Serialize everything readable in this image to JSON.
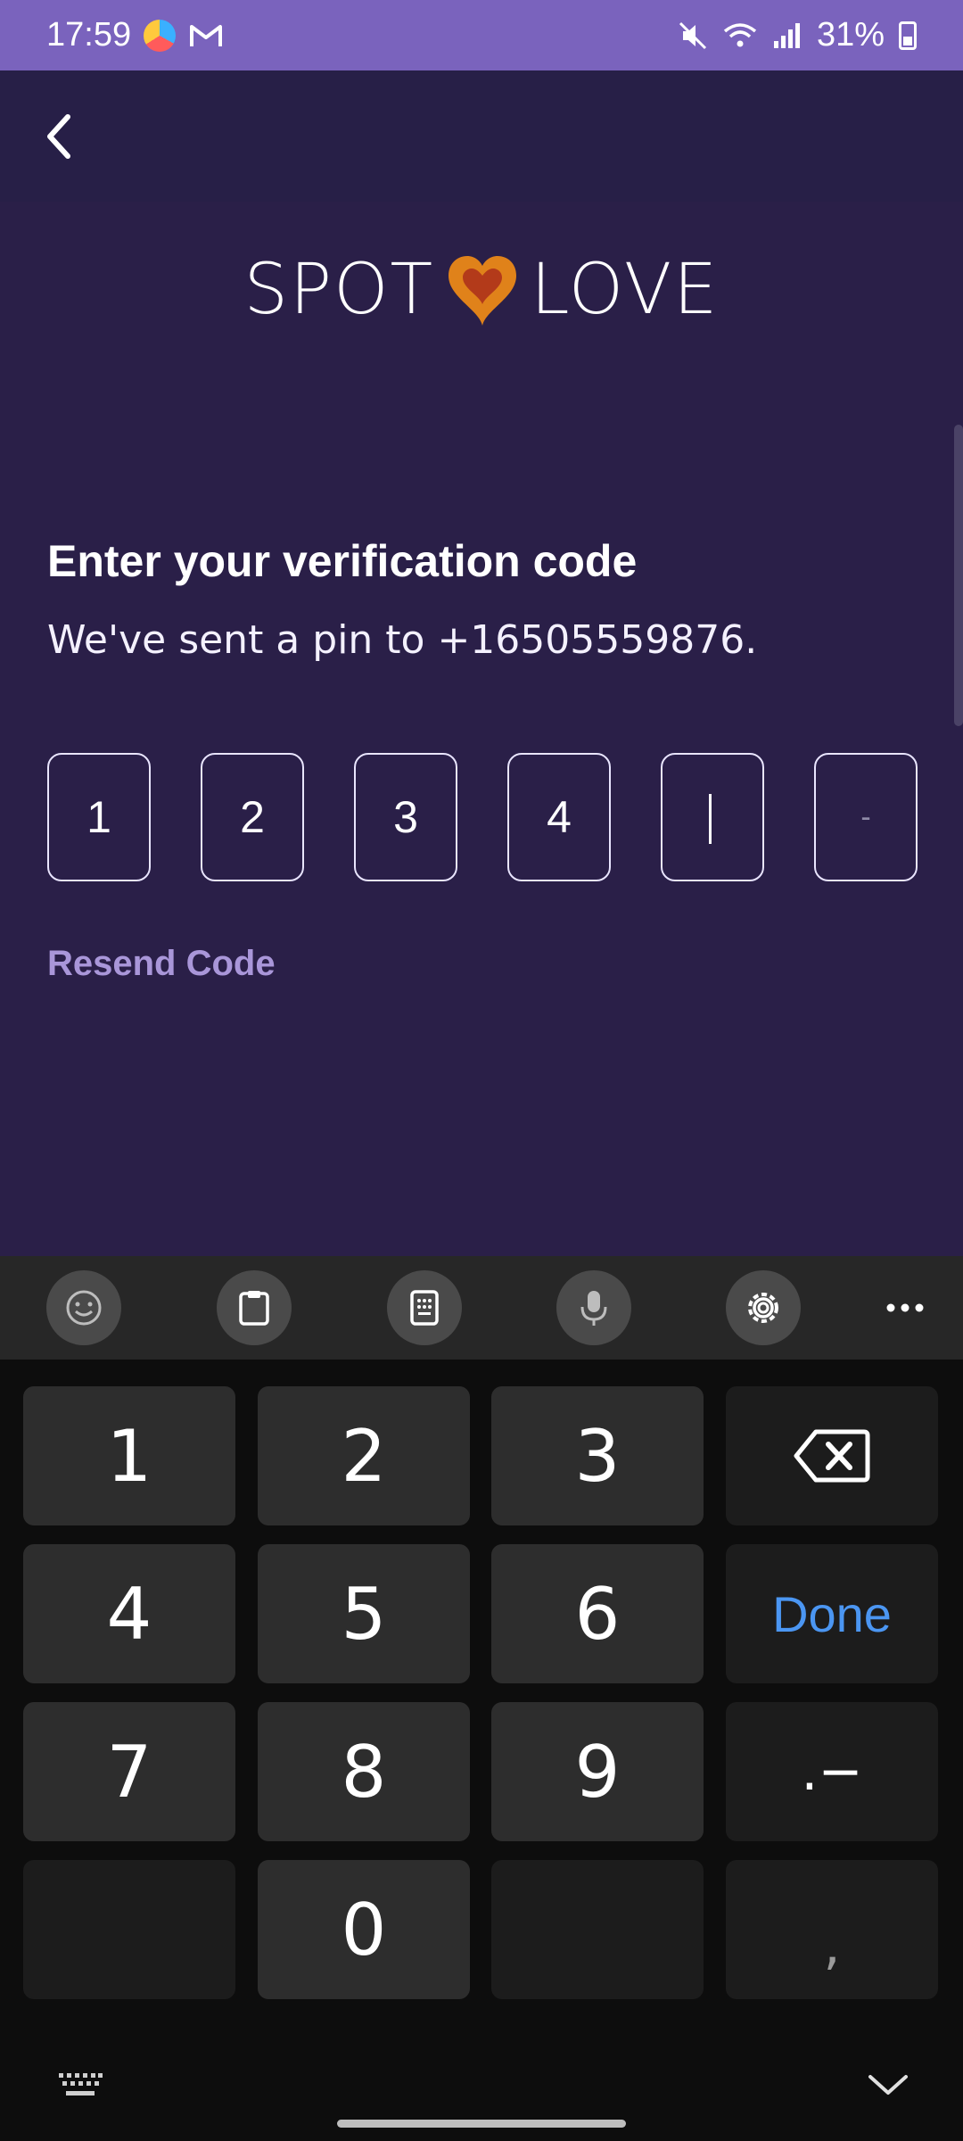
{
  "status_bar": {
    "time": "17:59",
    "battery": "31%"
  },
  "app": {
    "logo_left": "SPOT",
    "logo_right": "LOVE"
  },
  "page": {
    "title": "Enter your verification code",
    "subtitle": "We've sent a pin to +16505559876.",
    "code_digits": [
      "1",
      "2",
      "3",
      "4",
      "",
      "-"
    ],
    "resend_label": "Resend Code"
  },
  "keyboard": {
    "keys": {
      "k1": "1",
      "k2": "2",
      "k3": "3",
      "k4": "4",
      "k5": "5",
      "k6": "6",
      "k7": "7",
      "k8": "8",
      "k9": "9",
      "k0": "0",
      "done": "Done",
      "sym": ".−",
      "comma": ","
    }
  },
  "colors": {
    "status_bar": "#7a63bd",
    "background": "#2a1f48",
    "accent_link": "#a996d9",
    "done_key": "#4b96f2"
  }
}
